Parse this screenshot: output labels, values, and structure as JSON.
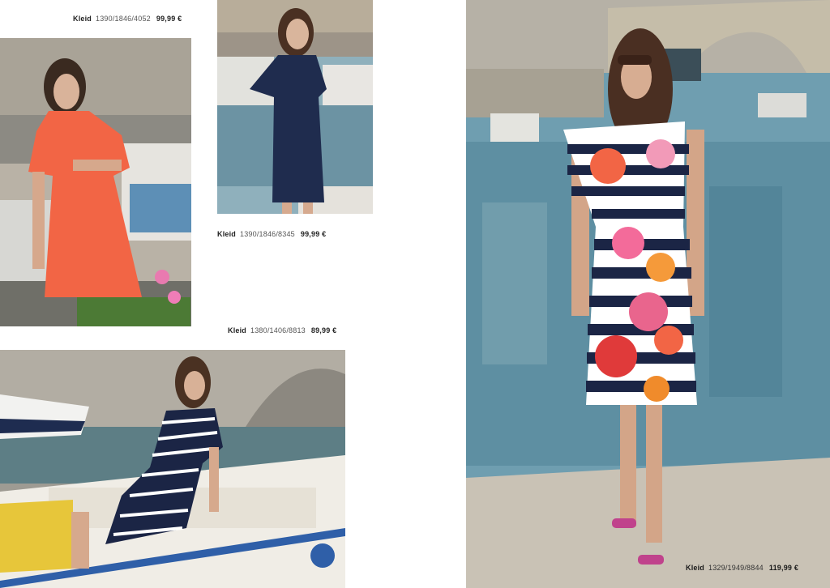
{
  "spread": {
    "products": [
      {
        "kind": "Kleid",
        "sku": "1390/1846/4052",
        "price": "99,99 €"
      },
      {
        "kind": "Kleid",
        "sku": "1390/1846/8345",
        "price": "99,99 €"
      },
      {
        "kind": "Kleid",
        "sku": "1380/1406/8813",
        "price": "89,99 €"
      },
      {
        "kind": "Kleid",
        "sku": "1329/1949/8844",
        "price": "119,99 €"
      }
    ],
    "colors": {
      "coral_dress": "#f26545",
      "navy_dress": "#1f2c4e",
      "stripe_navy": "#1b2545",
      "water": "#6f9eb0",
      "stone": "#c9c2b5"
    }
  }
}
